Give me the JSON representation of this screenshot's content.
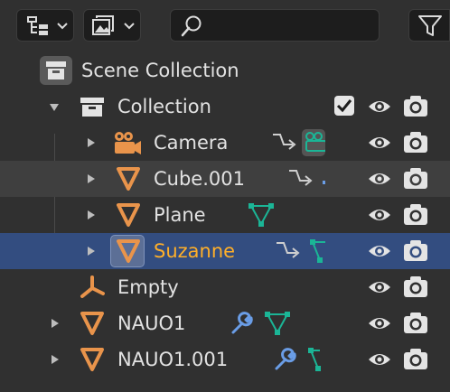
{
  "header": {
    "display_mode_icon": "outliner-view-icon",
    "filter_popover_icon": "image-stack-icon",
    "search": {
      "value": "",
      "placeholder": ""
    },
    "filter_icon": "funnel-icon"
  },
  "rows": [
    {
      "label": "Scene Collection",
      "icon": "scene-collection-icon"
    },
    {
      "label": "Collection",
      "icon": "collection-icon",
      "expanded": true,
      "checked": true
    },
    {
      "label": "Camera",
      "icon": "camera-object-icon",
      "expanded": false
    },
    {
      "label": "Cube.001",
      "icon": "mesh-object-icon",
      "expanded": false
    },
    {
      "label": "Plane",
      "icon": "mesh-object-icon",
      "expanded": false
    },
    {
      "label": "Suzanne",
      "icon": "mesh-object-icon",
      "expanded": false,
      "selected": true
    },
    {
      "label": "Empty",
      "icon": "empty-object-icon"
    },
    {
      "label": "NAUO1",
      "icon": "mesh-object-icon",
      "expanded": false
    },
    {
      "label": "NAUO1.001",
      "icon": "mesh-object-icon",
      "expanded": false
    }
  ],
  "colors": {
    "background": "#303030",
    "hover_row": "#3f3f3f",
    "selected_row": "#334d80",
    "selected_text": "#ffaf29",
    "object_orange": "#e9944b",
    "data_green": "#1bb596",
    "modifier_blue": "#6a9de6"
  }
}
